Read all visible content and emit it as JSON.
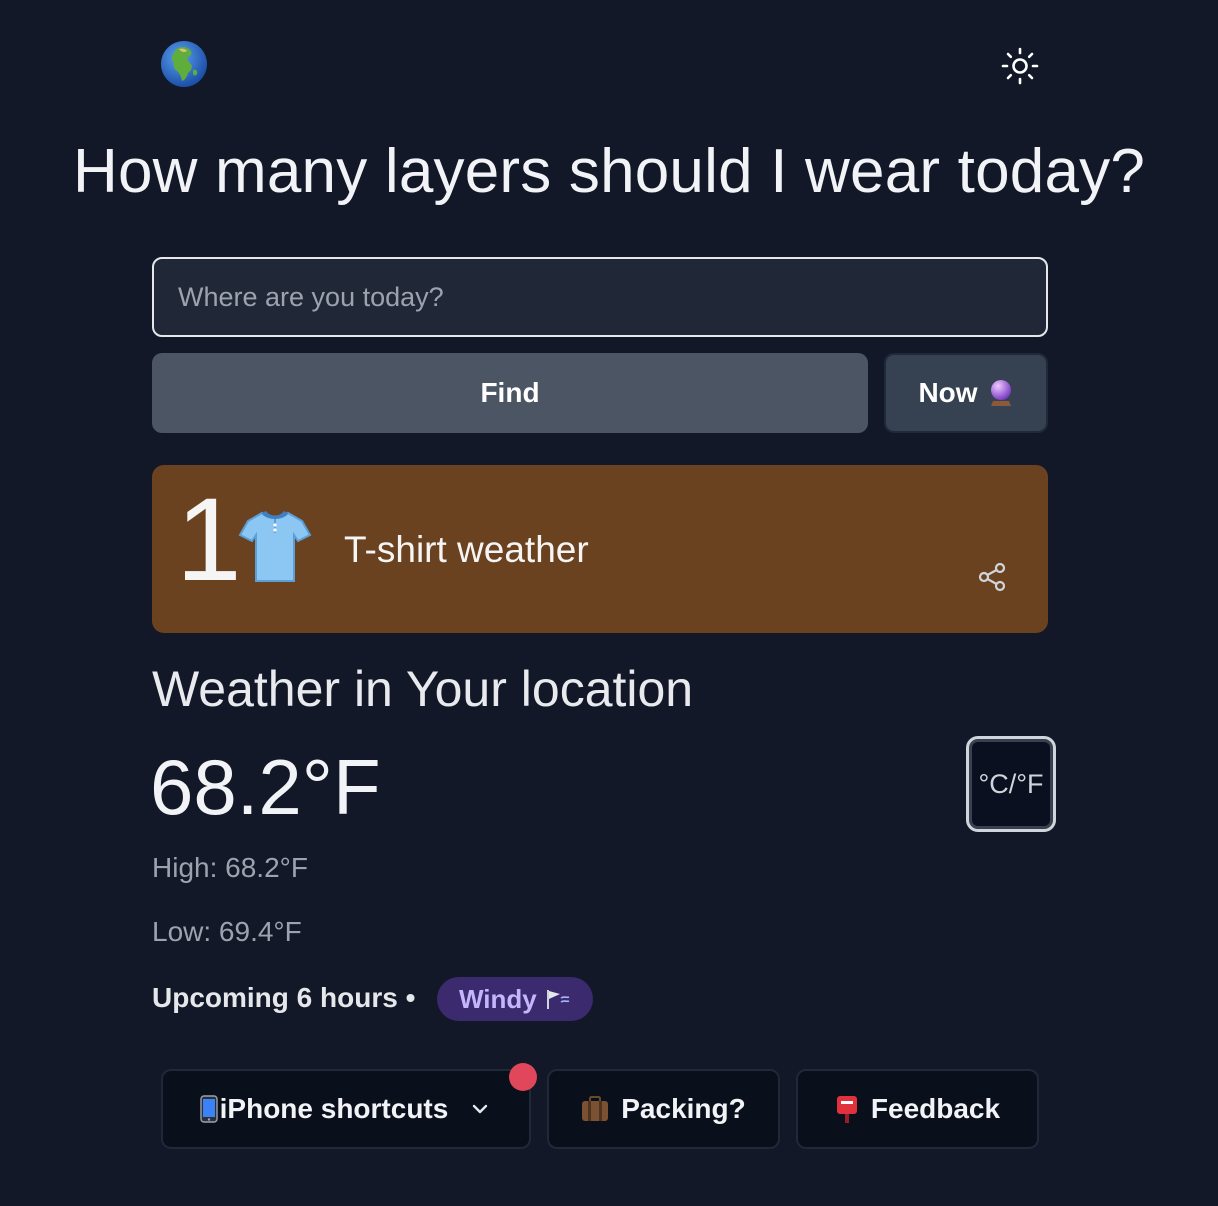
{
  "header": {
    "logo_icon": "globe-africa-icon",
    "theme_toggle_icon": "sun-icon"
  },
  "headline": "How many layers should I wear today?",
  "search": {
    "placeholder": "Where are you today?",
    "value": ""
  },
  "actions": {
    "find_label": "Find",
    "now_label": "Now",
    "now_icon": "crystal-ball-icon"
  },
  "result": {
    "layer_count": "1",
    "clothing_icon": "tshirt-icon",
    "label": "T-shirt weather",
    "share_icon": "share-icon",
    "background_color": "#6b421f"
  },
  "weather": {
    "title": "Weather in Your location",
    "current_temp": "68.2°F",
    "unit_toggle_label": "°C/°F",
    "high": "High: 68.2°F",
    "low": "Low: 69.4°F",
    "upcoming_label": "Upcoming 6 hours •",
    "badge_label": "Windy",
    "badge_icon": "wind-flag-icon"
  },
  "footer": {
    "shortcuts_label": "iPhone shortcuts",
    "shortcuts_icon": "phone-icon",
    "packing_label": "Packing?",
    "packing_icon": "luggage-icon",
    "feedback_label": "Feedback",
    "feedback_icon": "postbox-icon",
    "notification_color": "#e0475a"
  }
}
